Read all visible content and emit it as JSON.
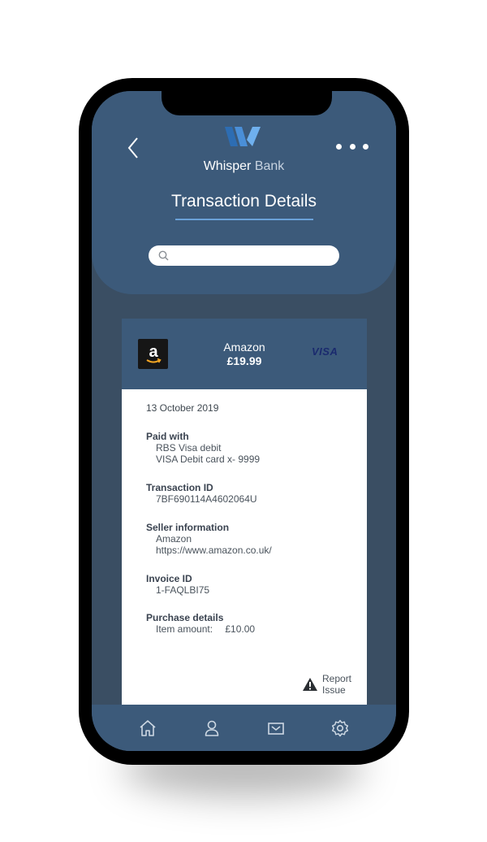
{
  "app": {
    "brand_primary": "Whisper",
    "brand_secondary": "Bank"
  },
  "header": {
    "title": "Transaction Details"
  },
  "search": {
    "placeholder": ""
  },
  "transaction": {
    "merchant": "Amazon",
    "amount": "£19.99",
    "card_brand": "VISA",
    "date": "13 October 2019",
    "paid_with": {
      "label": "Paid with",
      "line1": "RBS Visa debit",
      "line2": "VISA Debit card x- 9999"
    },
    "transaction_id": {
      "label": "Transaction ID",
      "value": "7BF690114A4602064U"
    },
    "seller": {
      "label": "Seller information",
      "name": "Amazon",
      "url": "https://www.amazon.co.uk/"
    },
    "invoice": {
      "label": "Invoice ID",
      "value": "1-FAQLBI75"
    },
    "purchase": {
      "label": "Purchase details",
      "item_label": "Item amount:",
      "item_value": "£10.00"
    }
  },
  "report": {
    "line1": "Report",
    "line2": "Issue"
  },
  "tabbar": {
    "icons": [
      "home-icon",
      "user-icon",
      "mail-icon",
      "settings-icon"
    ]
  },
  "colors": {
    "header": "#3c5a7a",
    "accent": "#6aa1d8",
    "background": "#3a4e63"
  }
}
